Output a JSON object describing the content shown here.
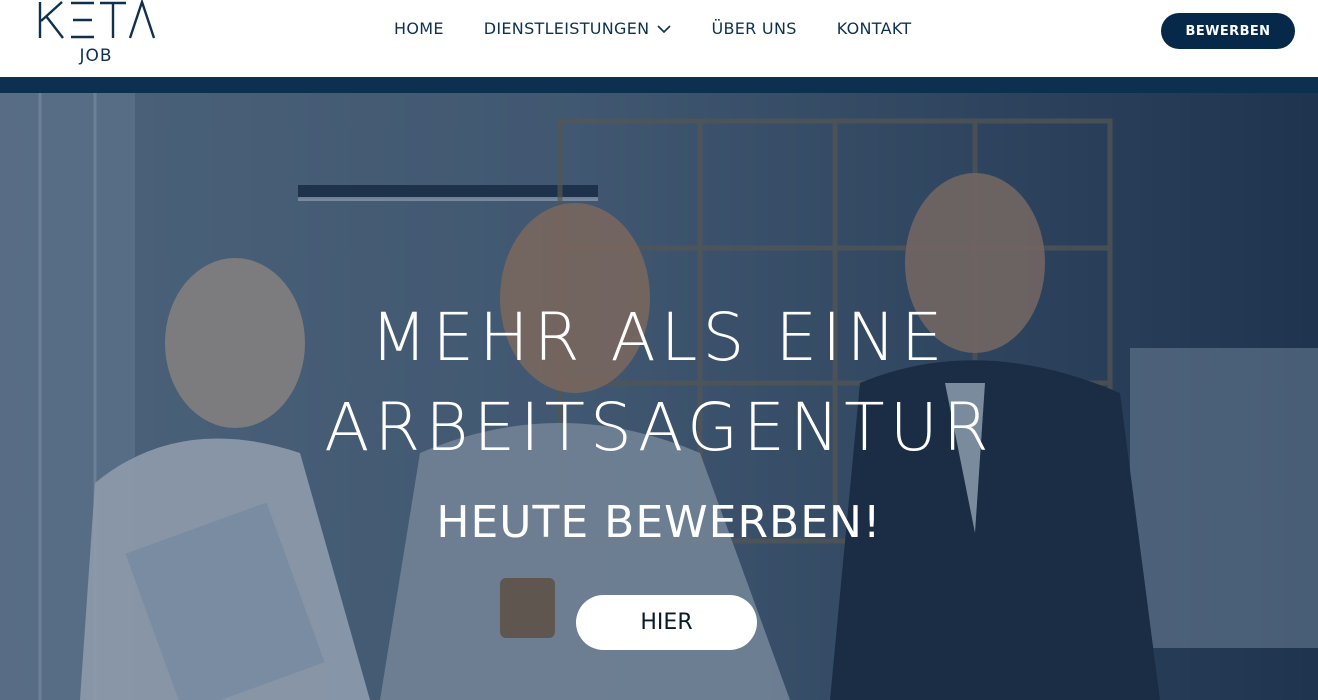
{
  "header": {
    "logo": {
      "text": "KETA",
      "sub": "JOB",
      "color": "#0e3150"
    },
    "nav": [
      {
        "label": "HOME"
      },
      {
        "label": "DIENSTLEISTUNGEN",
        "icon": "chevron-down-icon"
      },
      {
        "label": "ÜBER UNS"
      },
      {
        "label": "KONTAKT"
      }
    ],
    "cta_label": "BEWERBEN"
  },
  "hero": {
    "title_line1": "MEHR ALS EINE",
    "title_line2": "ARBEITSAGENTUR",
    "subtitle": "HEUTE BEWERBEN!",
    "button_label": "HIER"
  },
  "colors": {
    "brand_dark": "#06294a",
    "nav_text": "#0e3150",
    "accent_strip": "#0d3050",
    "hero_overlay": "#182f4e"
  }
}
